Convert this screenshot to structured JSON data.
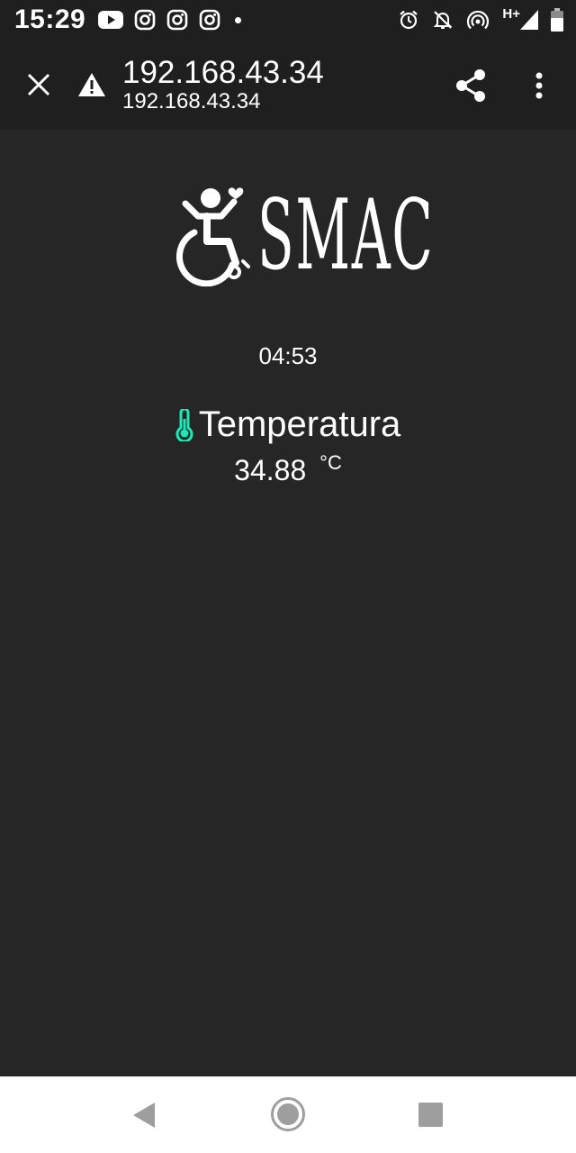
{
  "status_bar": {
    "time": "15:29",
    "network": "H+",
    "left_icons": [
      "youtube-icon",
      "instagram-icon",
      "instagram-icon",
      "instagram-icon",
      "dot-icon"
    ],
    "right_icons": [
      "alarm-icon",
      "notifications-off-icon",
      "hotspot-icon",
      "signal-icon",
      "battery-icon"
    ]
  },
  "browser": {
    "title": "192.168.43.34",
    "url": "192.168.43.34",
    "icons": [
      "close-icon",
      "warning-icon",
      "share-icon",
      "more-vert-icon"
    ]
  },
  "content": {
    "logo_text": "SMAC",
    "logo_icon": "wheelchair-heart-icon",
    "clock": "04:53",
    "temperature": {
      "label": "Temperatura",
      "value": "34.88",
      "unit": "°C",
      "icon": "thermometer-icon",
      "icon_color": "#1de9b6"
    }
  },
  "nav_bar": {
    "icons": [
      "back-icon",
      "home-icon",
      "recents-icon"
    ]
  },
  "colors": {
    "background": "#262626",
    "bar_background": "#1f1f1f",
    "accent": "#1de9b6",
    "nav_background": "#ffffff"
  }
}
